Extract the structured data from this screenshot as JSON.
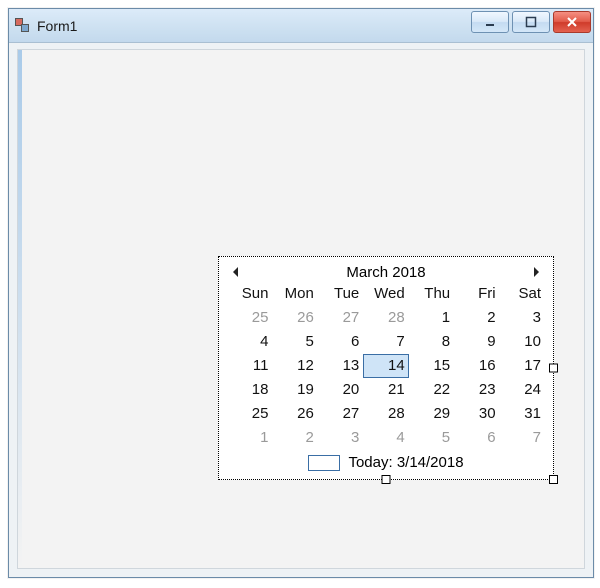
{
  "window": {
    "title": "Form1"
  },
  "calendar": {
    "month_label": "March 2018",
    "day_headers": [
      "Sun",
      "Mon",
      "Tue",
      "Wed",
      "Thu",
      "Fri",
      "Sat"
    ],
    "weeks": [
      [
        {
          "n": "25",
          "off": true
        },
        {
          "n": "26",
          "off": true
        },
        {
          "n": "27",
          "off": true
        },
        {
          "n": "28",
          "off": true
        },
        {
          "n": "1"
        },
        {
          "n": "2"
        },
        {
          "n": "3"
        }
      ],
      [
        {
          "n": "4"
        },
        {
          "n": "5"
        },
        {
          "n": "6"
        },
        {
          "n": "7"
        },
        {
          "n": "8"
        },
        {
          "n": "9"
        },
        {
          "n": "10"
        }
      ],
      [
        {
          "n": "11"
        },
        {
          "n": "12"
        },
        {
          "n": "13"
        },
        {
          "n": "14",
          "sel": true
        },
        {
          "n": "15"
        },
        {
          "n": "16"
        },
        {
          "n": "17"
        }
      ],
      [
        {
          "n": "18"
        },
        {
          "n": "19"
        },
        {
          "n": "20"
        },
        {
          "n": "21"
        },
        {
          "n": "22"
        },
        {
          "n": "23"
        },
        {
          "n": "24"
        }
      ],
      [
        {
          "n": "25"
        },
        {
          "n": "26"
        },
        {
          "n": "27"
        },
        {
          "n": "28"
        },
        {
          "n": "29"
        },
        {
          "n": "30"
        },
        {
          "n": "31"
        }
      ],
      [
        {
          "n": "1",
          "off": true
        },
        {
          "n": "2",
          "off": true
        },
        {
          "n": "3",
          "off": true
        },
        {
          "n": "4",
          "off": true
        },
        {
          "n": "5",
          "off": true
        },
        {
          "n": "6",
          "off": true
        },
        {
          "n": "7",
          "off": true
        }
      ]
    ],
    "today_label": "Today: 3/14/2018"
  }
}
